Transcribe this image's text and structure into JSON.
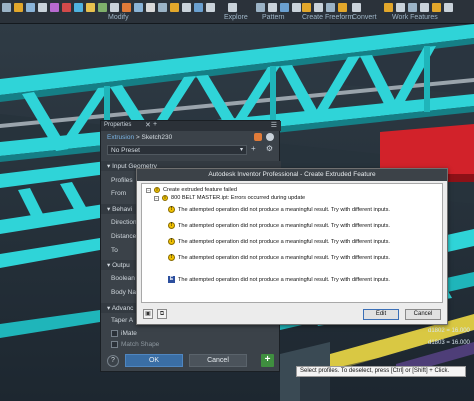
{
  "ribbon": {
    "groups": [
      "Modify",
      "Explore",
      "Pattern",
      "Create Freeform",
      "Convert",
      "Work Features"
    ]
  },
  "properties": {
    "tab_label": "Properties",
    "breadcrumb": {
      "feature": "Extrusion",
      "sketch": "Sketch230"
    },
    "preset": "No Preset",
    "sections": {
      "input_geometry": "Input Geometry",
      "behavior": "Behavi",
      "output": "Outpu",
      "advanced": "Advanc"
    },
    "rows": {
      "profiles": "Profiles",
      "from": "From",
      "direction": "Direction",
      "distance": "Distance A",
      "to": "To",
      "boolean": "Boolean",
      "body_name": "Body Nam",
      "taper": "Taper A",
      "imate": "iMate",
      "match_shape": "Match Shape"
    },
    "ok_label": "OK",
    "cancel_label": "Cancel"
  },
  "dialog": {
    "title": "Autodesk Inventor Professional - Create Extruded Feature",
    "messages": {
      "root": "Create extruded feature failed",
      "child": "800 BELT MASTER.ipt: Errors occurred during update",
      "detail": "The attempted operation did not produce a meaningful result. Try with different inputs."
    },
    "edit_label": "Edit",
    "cancel_label": "Cancel"
  },
  "status_text": "Select profiles. To deselect, press [Ctrl] or [Shift] + Click.",
  "dimensions": [
    "d1802 = 16.000",
    "d1803 = 16.000"
  ],
  "colors": {
    "truss": "#2fd4d8",
    "truss_dark": "#157f86",
    "red_part": "#d2222a",
    "yellow_part": "#d9c843",
    "purple_part": "#8b5bd1"
  }
}
